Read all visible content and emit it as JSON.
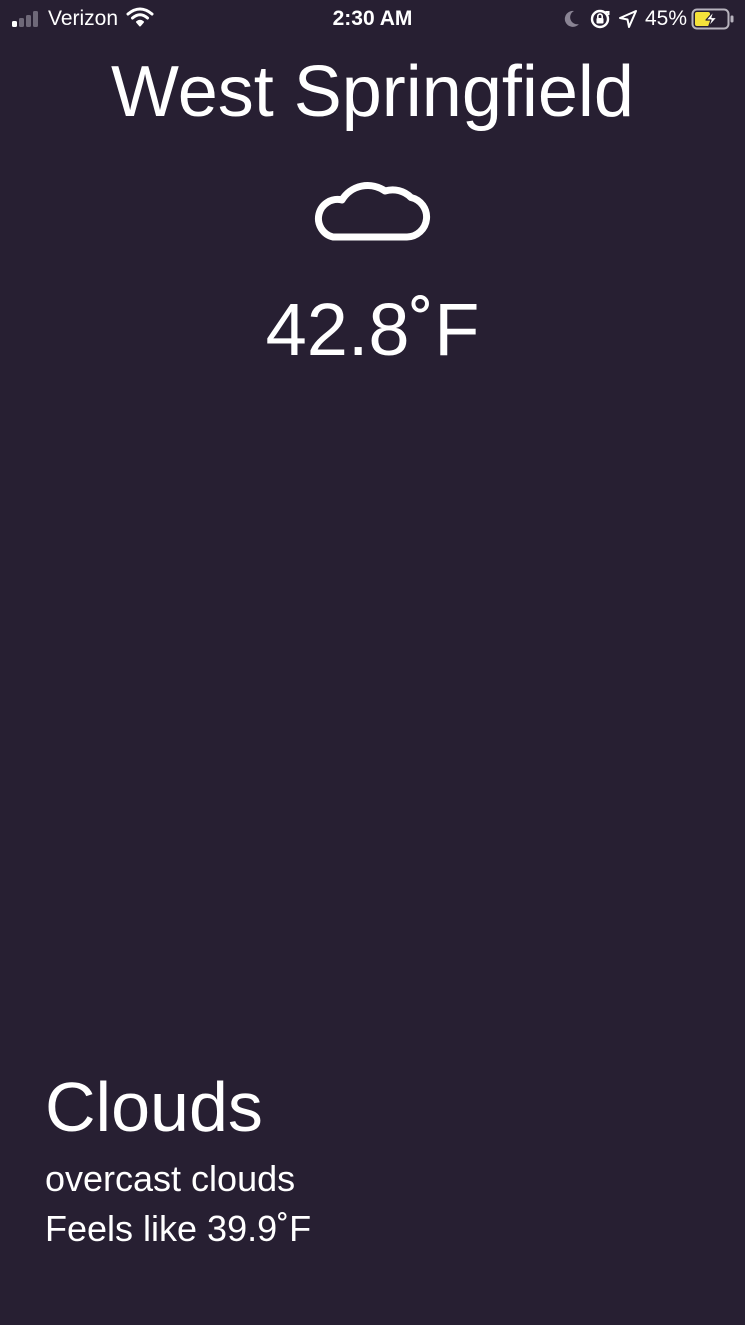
{
  "status_bar": {
    "carrier": "Verizon",
    "time": "2:30 AM",
    "battery_percent": "45%",
    "signal_bars_filled": 1,
    "signal_bars_total": 4,
    "icons": [
      "signal-icon",
      "wifi-icon",
      "moon-icon",
      "orientation-lock-icon",
      "location-arrow-icon",
      "battery-charging-icon"
    ]
  },
  "weather": {
    "city": "West Springfield",
    "icon": "cloud-icon",
    "temperature": "42.8˚F",
    "condition": "Clouds",
    "description": "overcast clouds",
    "feels_like": "Feels like 39.9˚F"
  },
  "colors": {
    "background": "#271f32",
    "text": "#ffffff",
    "battery_fill": "#f5e23a",
    "inactive_signal": "#6e6878"
  }
}
